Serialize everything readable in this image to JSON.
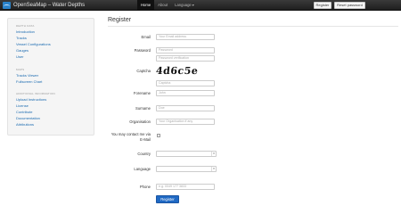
{
  "brand": {
    "title": "OpenSeaMap – Water Depths",
    "logo_icon": "openseamap-logo-icon"
  },
  "nav": {
    "items": [
      "Home",
      "About",
      "Language"
    ],
    "register": "Register",
    "reset_password": "Reset password"
  },
  "sidebar": {
    "sections": [
      {
        "header": "DEPTH DATA",
        "links": [
          "Introduction",
          "Tracks",
          "Vessel Configurations",
          "Gauges",
          "User"
        ]
      },
      {
        "header": "MAPS",
        "links": [
          "Tracks Viewer",
          "Fullscreen Chart"
        ]
      },
      {
        "header": "ADDITIONAL INFORMATION",
        "links": [
          "Upload Instructions",
          "License",
          "Contribute",
          "Documentation",
          "Attributions"
        ]
      }
    ]
  },
  "form": {
    "title": "Register",
    "email": {
      "label": "Email",
      "placeholder": "Your Email address"
    },
    "password": {
      "label": "Password",
      "placeholder": "Password",
      "verify_placeholder": "Password verification"
    },
    "captcha": {
      "label": "Captcha",
      "image_text": "4d6c5e",
      "placeholder": "Captcha"
    },
    "forename": {
      "label": "Forename",
      "placeholder": "John"
    },
    "surname": {
      "label": "Surname",
      "placeholder": "Doe"
    },
    "organisation": {
      "label": "Organisation",
      "placeholder": "Your Organisation if any"
    },
    "contact": {
      "label_line1": "You may contact me via",
      "label_line2": "E-Mail"
    },
    "country": {
      "label": "Country"
    },
    "language": {
      "label": "Language"
    },
    "phone": {
      "label": "Phone",
      "placeholder": "e.g. 0049 177 3833"
    },
    "submit": "Register"
  }
}
